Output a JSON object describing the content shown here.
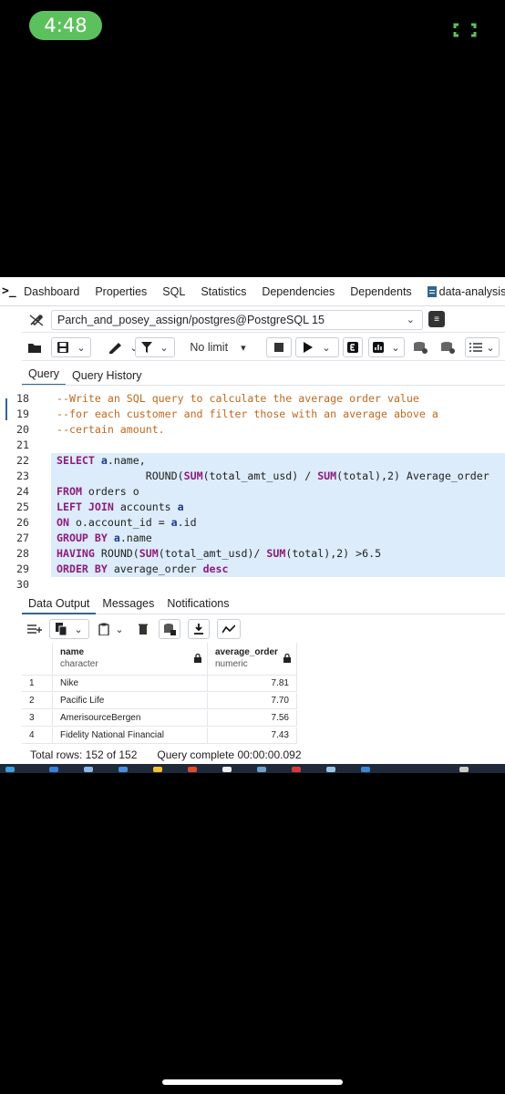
{
  "status": {
    "time": "4:48",
    "expand_icon": "expand-icon"
  },
  "app": {
    "terminal_glyph": ">_",
    "tabs": [
      {
        "label": "Dashboard"
      },
      {
        "label": "Properties"
      },
      {
        "label": "SQL"
      },
      {
        "label": "Statistics"
      },
      {
        "label": "Dependencies"
      },
      {
        "label": "Dependents"
      },
      {
        "label": "data-analysis-c",
        "icon": "document-icon",
        "active": true
      }
    ],
    "connection": "Parch_and_posey_assign/postgres@PostgreSQL 15",
    "limit_label": "No limit",
    "query_tabs": [
      {
        "label": "Query",
        "active": true
      },
      {
        "label": "Query History"
      }
    ]
  },
  "editor": {
    "lines": [
      {
        "n": "18",
        "segments": [
          {
            "t": "--Write an SQL query to calculate the average order value",
            "c": "cm"
          }
        ]
      },
      {
        "n": "19",
        "segments": [
          {
            "t": "--for each customer and filter those with an average above a",
            "c": "cm"
          }
        ]
      },
      {
        "n": "20",
        "segments": [
          {
            "t": "--certain amount.",
            "c": "cm"
          }
        ]
      },
      {
        "n": "21",
        "segments": []
      },
      {
        "n": "22",
        "selected": true,
        "segments": [
          {
            "t": "SELECT ",
            "c": "kw"
          },
          {
            "t": "a",
            "c": "al"
          },
          {
            "t": ".name,",
            "c": "fld"
          }
        ]
      },
      {
        "n": "23",
        "selected": true,
        "segments": [
          {
            "t": "              ROUND(",
            "c": "fld"
          },
          {
            "t": "SUM",
            "c": "kw"
          },
          {
            "t": "(total_amt_usd) / ",
            "c": "fld"
          },
          {
            "t": "SUM",
            "c": "kw"
          },
          {
            "t": "(total),2) Average_order",
            "c": "fld"
          }
        ]
      },
      {
        "n": "24",
        "selected": true,
        "segments": [
          {
            "t": "FROM ",
            "c": "kw"
          },
          {
            "t": "orders o",
            "c": "fld"
          }
        ]
      },
      {
        "n": "25",
        "selected": true,
        "segments": [
          {
            "t": "LEFT JOIN ",
            "c": "kw"
          },
          {
            "t": "accounts ",
            "c": "fld"
          },
          {
            "t": "a",
            "c": "al"
          }
        ]
      },
      {
        "n": "26",
        "selected": true,
        "segments": [
          {
            "t": "ON ",
            "c": "kw"
          },
          {
            "t": "o.account_id = ",
            "c": "fld"
          },
          {
            "t": "a",
            "c": "al"
          },
          {
            "t": ".id",
            "c": "fld"
          }
        ]
      },
      {
        "n": "27",
        "selected": true,
        "segments": [
          {
            "t": "GROUP BY ",
            "c": "kw"
          },
          {
            "t": "a",
            "c": "al"
          },
          {
            "t": ".name",
            "c": "fld"
          }
        ]
      },
      {
        "n": "28",
        "selected": true,
        "segments": [
          {
            "t": "HAVING ",
            "c": "kw"
          },
          {
            "t": "ROUND(",
            "c": "fld"
          },
          {
            "t": "SUM",
            "c": "kw"
          },
          {
            "t": "(total_amt_usd)/ ",
            "c": "fld"
          },
          {
            "t": "SUM",
            "c": "kw"
          },
          {
            "t": "(total),2) >6.5",
            "c": "fld"
          }
        ]
      },
      {
        "n": "29",
        "selected": true,
        "segments": [
          {
            "t": "ORDER BY ",
            "c": "kw"
          },
          {
            "t": "average_order ",
            "c": "fld"
          },
          {
            "t": "desc",
            "c": "kw"
          }
        ]
      },
      {
        "n": "30",
        "segments": []
      }
    ]
  },
  "output": {
    "tabs": [
      {
        "label": "Data Output",
        "active": true
      },
      {
        "label": "Messages"
      },
      {
        "label": "Notifications"
      }
    ],
    "columns": [
      {
        "name": "name",
        "type": "character"
      },
      {
        "name": "average_order",
        "type": "numeric"
      }
    ],
    "rows": [
      {
        "idx": "1",
        "name": "Nike",
        "avg": "7.81"
      },
      {
        "idx": "2",
        "name": "Pacific Life",
        "avg": "7.70"
      },
      {
        "idx": "3",
        "name": "AmerisourceBergen",
        "avg": "7.56"
      },
      {
        "idx": "4",
        "name": "Fidelity National Financial",
        "avg": "7.43"
      }
    ],
    "total_rows": "Total rows: 152 of 152",
    "query_status": "Query complete 00:00:00.092"
  },
  "colors": {
    "accent": "#326690",
    "selection": "#dcecfa",
    "keyword": "#8c1b7d",
    "comment": "#c0691f",
    "status_green": "#5cc15d"
  }
}
